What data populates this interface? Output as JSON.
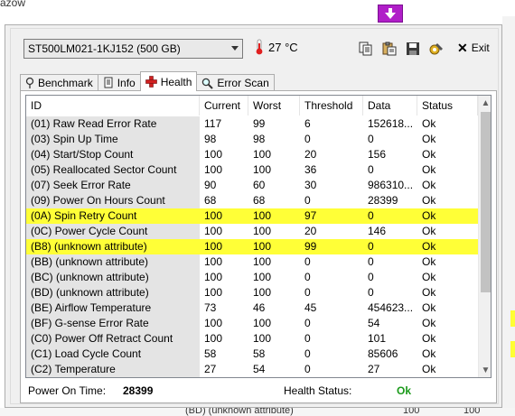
{
  "background": {
    "top_text": "ażów",
    "bottom_fragment_1": "(BD) (unknown attribute)",
    "bottom_fragment_2": "100",
    "bottom_fragment_3": "100"
  },
  "window": {
    "drive": "ST500LM021-1KJ152 (500 GB)",
    "temperature": "27 °C",
    "exit_label": "Exit",
    "toolbar_icons": [
      "copy-icon",
      "paste-icon",
      "save-icon",
      "options-icon"
    ]
  },
  "tabs": [
    {
      "label": "Benchmark",
      "icon": "benchmark-icon",
      "active": false
    },
    {
      "label": "Info",
      "icon": "info-icon",
      "active": false
    },
    {
      "label": "Health",
      "icon": "health-cross-icon",
      "active": true
    },
    {
      "label": "Error Scan",
      "icon": "magnifier-icon",
      "active": false
    }
  ],
  "table": {
    "columns": [
      "ID",
      "Current",
      "Worst",
      "Threshold",
      "Data",
      "Status"
    ],
    "rows": [
      {
        "id": "(01) Raw Read Error Rate",
        "current": "117",
        "worst": "99",
        "threshold": "6",
        "data": "152618...",
        "status": "Ok",
        "highlight": false
      },
      {
        "id": "(03) Spin Up Time",
        "current": "98",
        "worst": "98",
        "threshold": "0",
        "data": "0",
        "status": "Ok",
        "highlight": false
      },
      {
        "id": "(04) Start/Stop Count",
        "current": "100",
        "worst": "100",
        "threshold": "20",
        "data": "156",
        "status": "Ok",
        "highlight": false
      },
      {
        "id": "(05) Reallocated Sector Count",
        "current": "100",
        "worst": "100",
        "threshold": "36",
        "data": "0",
        "status": "Ok",
        "highlight": false
      },
      {
        "id": "(07) Seek Error Rate",
        "current": "90",
        "worst": "60",
        "threshold": "30",
        "data": "986310...",
        "status": "Ok",
        "highlight": false
      },
      {
        "id": "(09) Power On Hours Count",
        "current": "68",
        "worst": "68",
        "threshold": "0",
        "data": "28399",
        "status": "Ok",
        "highlight": false
      },
      {
        "id": "(0A) Spin Retry Count",
        "current": "100",
        "worst": "100",
        "threshold": "97",
        "data": "0",
        "status": "Ok",
        "highlight": true
      },
      {
        "id": "(0C) Power Cycle Count",
        "current": "100",
        "worst": "100",
        "threshold": "20",
        "data": "146",
        "status": "Ok",
        "highlight": false
      },
      {
        "id": "(B8) (unknown attribute)",
        "current": "100",
        "worst": "100",
        "threshold": "99",
        "data": "0",
        "status": "Ok",
        "highlight": true
      },
      {
        "id": "(BB) (unknown attribute)",
        "current": "100",
        "worst": "100",
        "threshold": "0",
        "data": "0",
        "status": "Ok",
        "highlight": false
      },
      {
        "id": "(BC) (unknown attribute)",
        "current": "100",
        "worst": "100",
        "threshold": "0",
        "data": "0",
        "status": "Ok",
        "highlight": false
      },
      {
        "id": "(BD) (unknown attribute)",
        "current": "100",
        "worst": "100",
        "threshold": "0",
        "data": "0",
        "status": "Ok",
        "highlight": false
      },
      {
        "id": "(BE) Airflow Temperature",
        "current": "73",
        "worst": "46",
        "threshold": "45",
        "data": "454623...",
        "status": "Ok",
        "highlight": false
      },
      {
        "id": "(BF) G-sense Error Rate",
        "current": "100",
        "worst": "100",
        "threshold": "0",
        "data": "54",
        "status": "Ok",
        "highlight": false
      },
      {
        "id": "(C0) Power Off Retract Count",
        "current": "100",
        "worst": "100",
        "threshold": "0",
        "data": "101",
        "status": "Ok",
        "highlight": false
      },
      {
        "id": "(C1) Load Cycle Count",
        "current": "58",
        "worst": "58",
        "threshold": "0",
        "data": "85606",
        "status": "Ok",
        "highlight": false
      },
      {
        "id": "(C2) Temperature",
        "current": "27",
        "worst": "54",
        "threshold": "0",
        "data": "27",
        "status": "Ok",
        "highlight": false
      }
    ]
  },
  "footer": {
    "power_on_label": "Power On Time:",
    "power_on_value": "28399",
    "health_label": "Health Status:",
    "health_value": "Ok"
  },
  "colors": {
    "highlight": "#ffff37",
    "ok_green": "#1a9a1a",
    "temp_red": "#e02020"
  }
}
